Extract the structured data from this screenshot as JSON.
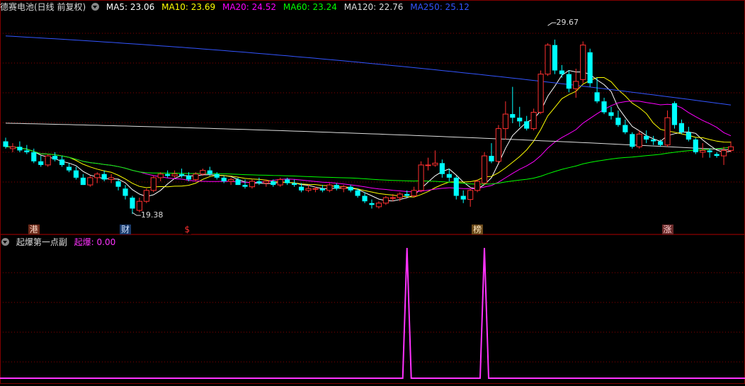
{
  "main": {
    "title": "德赛电池(日线 前复权)",
    "indicators": [
      {
        "label": "MA5: 23.06",
        "color": "#ffffff"
      },
      {
        "label": "MA10: 23.69",
        "color": "#ffff00"
      },
      {
        "label": "MA20: 24.52",
        "color": "#ff00ff"
      },
      {
        "label": "MA60: 23.24",
        "color": "#00ff00"
      },
      {
        "label": "MA120: 22.76",
        "color": "#dddddd"
      },
      {
        "label": "MA250: 25.12",
        "color": "#3355ff"
      }
    ],
    "high_label": "29.67",
    "low_label": "19.38",
    "event_markers": [
      {
        "text": "港",
        "bg": "#6b2a1a",
        "color": "#ffddcc"
      },
      {
        "text": "财",
        "bg": "#1a3a6b",
        "color": "#cce0ff"
      },
      {
        "text": "$",
        "bg": "#000000",
        "color": "#ff3030"
      },
      {
        "text": "榜",
        "bg": "#6b4a1a",
        "color": "#ffe8c0"
      },
      {
        "text": "涨",
        "bg": "#6b2a2a",
        "color": "#ffd0d0"
      }
    ]
  },
  "sub": {
    "title": "起爆第一点副",
    "indicator_label": "起爆: 0.00",
    "indicator_color": "#ff33ff"
  },
  "chart_data": [
    {
      "type": "candlestick",
      "title": "德赛电池(日线 前复权)",
      "colors": {
        "up": "#ff3030",
        "down": "#00ffff"
      },
      "ylim": [
        18.8,
        30.3
      ],
      "candles": [
        [
          23.3,
          23.5,
          22.9,
          23.0
        ],
        [
          22.9,
          23.2,
          22.7,
          23.0
        ],
        [
          23.0,
          23.3,
          22.7,
          22.8
        ],
        [
          22.8,
          23.1,
          22.6,
          22.7
        ],
        [
          22.7,
          22.9,
          22.1,
          22.2
        ],
        [
          22.2,
          22.5,
          21.9,
          22.0
        ],
        [
          22.0,
          22.6,
          21.9,
          22.5
        ],
        [
          22.5,
          22.7,
          22.2,
          22.3
        ],
        [
          22.3,
          22.5,
          21.9,
          22.0
        ],
        [
          21.9,
          22.1,
          21.6,
          21.7
        ],
        [
          21.7,
          21.9,
          21.2,
          21.3
        ],
        [
          21.3,
          21.5,
          20.9,
          20.9
        ],
        [
          20.9,
          21.4,
          20.8,
          21.3
        ],
        [
          21.3,
          21.6,
          21.0,
          21.5
        ],
        [
          21.5,
          21.7,
          21.1,
          21.2
        ],
        [
          21.2,
          21.5,
          21.0,
          21.3
        ],
        [
          21.1,
          21.2,
          20.6,
          20.8
        ],
        [
          20.7,
          20.9,
          20.1,
          20.3
        ],
        [
          20.2,
          20.3,
          19.3,
          19.6
        ],
        [
          19.5,
          20.2,
          19.4,
          20.0
        ],
        [
          20.0,
          20.7,
          19.9,
          20.6
        ],
        [
          20.6,
          21.4,
          20.5,
          21.3
        ],
        [
          21.3,
          21.6,
          21.1,
          21.5
        ],
        [
          21.5,
          21.7,
          21.3,
          21.4
        ],
        [
          21.4,
          21.7,
          21.3,
          21.5
        ],
        [
          21.5,
          21.8,
          21.3,
          21.4
        ],
        [
          21.4,
          21.6,
          21.1,
          21.2
        ],
        [
          21.2,
          21.6,
          21.1,
          21.5
        ],
        [
          21.5,
          21.8,
          21.4,
          21.7
        ],
        [
          21.7,
          21.9,
          21.4,
          21.5
        ],
        [
          21.5,
          21.6,
          21.2,
          21.3
        ],
        [
          21.3,
          21.4,
          21.0,
          21.1
        ],
        [
          21.1,
          21.3,
          20.9,
          21.2
        ],
        [
          21.2,
          21.3,
          20.9,
          20.9
        ],
        [
          20.9,
          21.2,
          20.7,
          20.8
        ],
        [
          20.8,
          21.2,
          20.7,
          21.1
        ],
        [
          21.1,
          21.3,
          20.9,
          21.0
        ],
        [
          21.0,
          21.2,
          20.8,
          21.1
        ],
        [
          21.1,
          21.2,
          20.8,
          20.9
        ],
        [
          20.9,
          21.3,
          20.8,
          21.2
        ],
        [
          21.2,
          21.3,
          20.9,
          21.0
        ],
        [
          21.0,
          21.2,
          20.8,
          20.9
        ],
        [
          20.8,
          21.0,
          20.5,
          20.6
        ],
        [
          20.6,
          20.9,
          20.5,
          20.7
        ],
        [
          20.7,
          20.8,
          20.5,
          20.7
        ],
        [
          20.7,
          20.9,
          20.5,
          20.6
        ],
        [
          20.6,
          21.0,
          20.5,
          20.9
        ],
        [
          20.9,
          21.0,
          20.6,
          20.7
        ],
        [
          20.7,
          20.9,
          20.5,
          20.8
        ],
        [
          20.8,
          20.9,
          20.5,
          20.6
        ],
        [
          20.6,
          20.7,
          20.2,
          20.3
        ],
        [
          20.3,
          20.5,
          19.9,
          20.0
        ],
        [
          19.9,
          20.1,
          19.6,
          19.8
        ],
        [
          19.7,
          20.0,
          19.6,
          19.9
        ],
        [
          19.9,
          20.3,
          19.8,
          20.2
        ],
        [
          20.2,
          20.4,
          20.0,
          20.2
        ],
        [
          20.2,
          20.5,
          20.0,
          20.4
        ],
        [
          20.4,
          20.6,
          20.2,
          20.3
        ],
        [
          20.3,
          20.8,
          20.2,
          20.6
        ],
        [
          20.6,
          22.2,
          20.5,
          22.0
        ],
        [
          22.0,
          22.4,
          21.7,
          22.0
        ],
        [
          22.0,
          22.8,
          21.9,
          22.1
        ],
        [
          22.1,
          22.3,
          21.3,
          21.5
        ],
        [
          21.5,
          21.8,
          21.1,
          21.3
        ],
        [
          21.3,
          21.4,
          20.1,
          20.3
        ],
        [
          20.3,
          20.6,
          19.9,
          20.1
        ],
        [
          20.1,
          20.7,
          19.7,
          20.6
        ],
        [
          20.6,
          21.2,
          20.5,
          21.1
        ],
        [
          21.0,
          22.7,
          20.9,
          22.5
        ],
        [
          22.5,
          23.2,
          22.1,
          22.2
        ],
        [
          22.2,
          24.2,
          22.1,
          24.0
        ],
        [
          24.0,
          25.5,
          23.4,
          24.8
        ],
        [
          24.8,
          26.3,
          24.3,
          24.6
        ],
        [
          24.6,
          25.2,
          24.1,
          24.4
        ],
        [
          24.4,
          24.7,
          23.9,
          24.0
        ],
        [
          24.0,
          25.1,
          23.9,
          24.9
        ],
        [
          24.9,
          27.2,
          24.8,
          27.0
        ],
        [
          27.0,
          28.7,
          26.9,
          28.6
        ],
        [
          28.6,
          28.9,
          27.0,
          27.2
        ],
        [
          27.2,
          27.5,
          26.8,
          27.0
        ],
        [
          27.0,
          27.2,
          26.0,
          26.2
        ],
        [
          26.2,
          27.3,
          25.7,
          26.6
        ],
        [
          26.7,
          28.8,
          26.5,
          28.6
        ],
        [
          28.2,
          28.4,
          26.3,
          26.5
        ],
        [
          26.0,
          26.8,
          25.4,
          25.5
        ],
        [
          25.5,
          25.7,
          24.8,
          24.9
        ],
        [
          24.9,
          25.2,
          24.5,
          24.7
        ],
        [
          24.6,
          25.0,
          24.1,
          24.2
        ],
        [
          24.2,
          24.5,
          23.7,
          23.8
        ],
        [
          23.7,
          23.8,
          22.9,
          23.0
        ],
        [
          23.0,
          23.9,
          22.9,
          23.7
        ],
        [
          23.6,
          23.9,
          23.2,
          23.4
        ],
        [
          23.4,
          23.6,
          23.1,
          23.3
        ],
        [
          23.3,
          23.4,
          23.0,
          23.1
        ],
        [
          23.1,
          25.0,
          23.0,
          24.6
        ],
        [
          25.4,
          25.5,
          24.0,
          24.2
        ],
        [
          24.3,
          24.5,
          23.7,
          23.8
        ],
        [
          23.8,
          24.1,
          23.3,
          23.4
        ],
        [
          23.4,
          23.5,
          22.6,
          22.7
        ],
        [
          22.7,
          23.2,
          22.4,
          22.8
        ],
        [
          22.8,
          22.9,
          22.4,
          22.7
        ],
        [
          22.6,
          22.7,
          22.4,
          22.5
        ],
        [
          22.5,
          23.0,
          22.0,
          22.8
        ],
        [
          22.8,
          23.3,
          22.7,
          23.0
        ]
      ],
      "moving_averages": [
        {
          "name": "MA5",
          "color": "#ffffff",
          "period": 5
        },
        {
          "name": "MA10",
          "color": "#ffff00",
          "period": 10
        },
        {
          "name": "MA20",
          "color": "#ff00ff",
          "period": 20
        },
        {
          "name": "MA60",
          "color": "#00ff00",
          "period": 60
        },
        {
          "name": "MA120",
          "color": "#dddddd",
          "values_from": 24.3,
          "values_to": 22.76
        },
        {
          "name": "MA250",
          "color": "#3355ff",
          "values_from": 29.1,
          "values_to": 25.12
        }
      ],
      "annotations": [
        {
          "text": "29.67",
          "x_index": 77,
          "y": 29.67
        },
        {
          "text": "19.38",
          "x_index": 18,
          "y": 19.38
        }
      ],
      "markers_x_index": [
        4,
        17,
        26,
        67,
        94
      ]
    },
    {
      "type": "line",
      "title": "起爆第一点副",
      "series": [
        {
          "name": "起爆",
          "color": "#ff33ff",
          "spikes_x_index": [
            57,
            68
          ]
        }
      ],
      "ylim": [
        0,
        1
      ]
    }
  ]
}
